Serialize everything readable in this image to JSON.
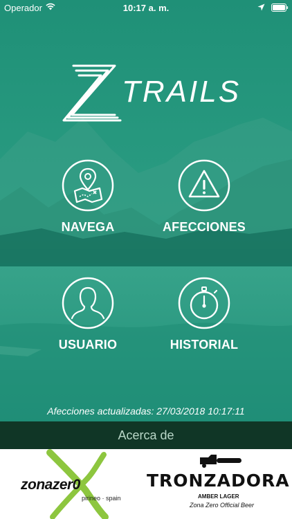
{
  "status": {
    "carrier": "Operador",
    "time": "10:17 a. m."
  },
  "logo": {
    "text": "TRAILS"
  },
  "menu": {
    "navega": "NAVEGA",
    "afecciones": "AFECCIONES",
    "usuario": "USUARIO",
    "historial": "HISTORIAL"
  },
  "updated_text": "Afecciones actualizadas: 27/03/2018 10:17:11",
  "about_label": "Acerca de",
  "sponsors": {
    "zona_name": "zonazer0",
    "zona_tag": "pirineo · spain",
    "tron_name": "TRONZADORA",
    "tron_sub": "AMBER LAGER",
    "tron_tag": "Zona Zero Official Beer"
  },
  "colors": {
    "accent": "#1a8a72",
    "about_bar": "#103626",
    "zona_x": "#8dc63f"
  }
}
